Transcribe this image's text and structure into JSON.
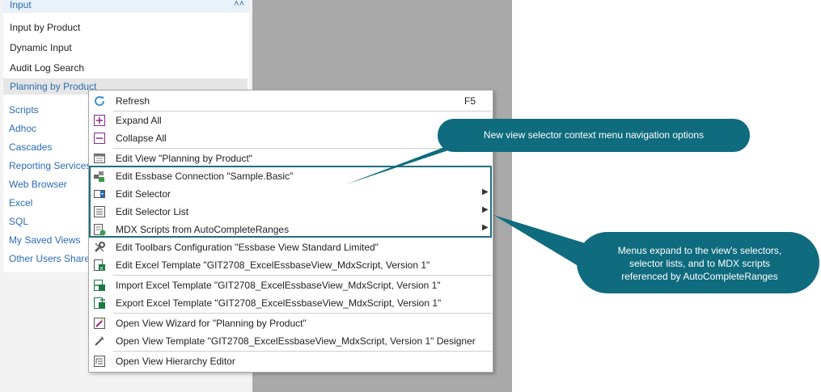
{
  "sidebar": {
    "section_title": "Input",
    "items": [
      "Input by Product",
      "Dynamic Input",
      "Audit Log Search"
    ],
    "selected_item": "Planning by Product",
    "groups": [
      "Scripts",
      "Adhoc",
      "Cascades",
      "Reporting Services",
      "Web Browser",
      "Excel",
      "SQL",
      "My Saved Views",
      "Other Users Shared"
    ]
  },
  "context_menu": {
    "items": [
      {
        "label": "Refresh",
        "shortcut": "F5",
        "icon": "refresh-icon"
      },
      {
        "label": "Expand All",
        "icon": "expand-all-icon"
      },
      {
        "label": "Collapse All",
        "icon": "collapse-all-icon"
      },
      {
        "label": "Edit View \"Planning by Product\"",
        "icon": "edit-view-icon"
      },
      {
        "label": "Edit Essbase Connection \"Sample.Basic\"",
        "icon": "essbase-connection-icon"
      },
      {
        "label": "Edit Selector",
        "icon": "edit-selector-icon",
        "submenu": true
      },
      {
        "label": "Edit Selector List",
        "icon": "selector-list-icon",
        "submenu": true
      },
      {
        "label": "MDX Scripts from AutoCompleteRanges",
        "icon": "mdx-script-icon",
        "submenu": true
      },
      {
        "label": "Edit Toolbars Configuration \"Essbase View Standard Limited\"",
        "icon": "toolbar-config-icon"
      },
      {
        "label": "Edit Excel Template \"GIT2708_ExcelEssbaseView_MdxScript, Version 1\"",
        "icon": "excel-template-icon"
      },
      {
        "label": "Import Excel Template \"GIT2708_ExcelEssbaseView_MdxScript, Version 1\"",
        "icon": "import-excel-icon"
      },
      {
        "label": "Export Excel Template \"GIT2708_ExcelEssbaseView_MdxScript, Version 1\"",
        "icon": "export-excel-icon"
      },
      {
        "label": "Open View Wizard for \"Planning by Product\"",
        "icon": "wizard-icon"
      },
      {
        "label": "Open View Template \"GIT2708_ExcelEssbaseView_MdxScript, Version 1\" Designer",
        "icon": "template-designer-icon"
      },
      {
        "label": "Open View Hierarchy Editor",
        "icon": "hierarchy-editor-icon"
      }
    ]
  },
  "callouts": {
    "top": "New view selector context menu navigation options",
    "bottom_lines": [
      "Menus expand to the view's selectors,",
      "selector lists, and to MDX scripts",
      "referenced by AutoCompleteRanges"
    ]
  },
  "colors": {
    "callout": "#0f6b7e",
    "accent": "#2a6db5",
    "highlight_border": "#1f6f7c"
  }
}
